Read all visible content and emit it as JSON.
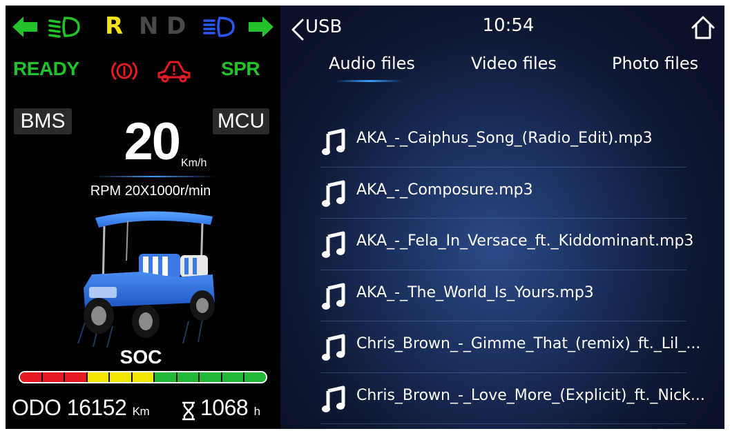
{
  "dashboard": {
    "gears": [
      "R",
      "N",
      "D"
    ],
    "selected_gear": "R",
    "status": {
      "ready": "READY",
      "spr": "SPR"
    },
    "tags": {
      "bms": "BMS",
      "mcu": "MCU"
    },
    "speed": {
      "value": "20",
      "unit": "Km/h"
    },
    "rpm": "RPM 20X1000r/min",
    "soc": {
      "label": "SOC",
      "segments": [
        "#e41b23",
        "#e41b23",
        "#e41b23",
        "#f2e600",
        "#f2e600",
        "#f2e600",
        "#21b838",
        "#21b838",
        "#21b838",
        "#21b838",
        "#21b838"
      ]
    },
    "odo": {
      "label": "ODO",
      "value": "16152",
      "unit": "Km"
    },
    "hours": {
      "value": "1068",
      "unit": "h"
    },
    "colors": {
      "green": "#22c22b",
      "yellow": "#f5e31a",
      "blue": "#2a56f0",
      "red": "#e41b23",
      "inactive": "#4a4a4a"
    },
    "icons": [
      "left-turn-arrow-icon",
      "low-beam-icon",
      "high-beam-icon",
      "right-turn-arrow-icon",
      "parking-brake-icon",
      "vehicle-fault-icon",
      "hourglass-icon"
    ]
  },
  "media": {
    "source": "USB",
    "time": "10:54",
    "tabs": [
      {
        "label": "Audio files",
        "active": true
      },
      {
        "label": "Video files",
        "active": false
      },
      {
        "label": "Photo files",
        "active": false
      }
    ],
    "files": [
      "AKA_-_Caiphus_Song_(Radio_Edit).mp3",
      "AKA_-_Composure.mp3",
      "AKA_-_Fela_In_Versace_ft._Kiddominant.mp3",
      "AKA_-_The_World_Is_Yours.mp3",
      "Chris_Brown_-_Gimme_That_(remix)_ft._Lil_...",
      "Chris_Brown_-_Love_More_(Explicit)_ft._Nick..."
    ],
    "accent": "#3aa0ff",
    "icons": [
      "back-chevron-icon",
      "home-icon",
      "music-note-icon"
    ]
  }
}
